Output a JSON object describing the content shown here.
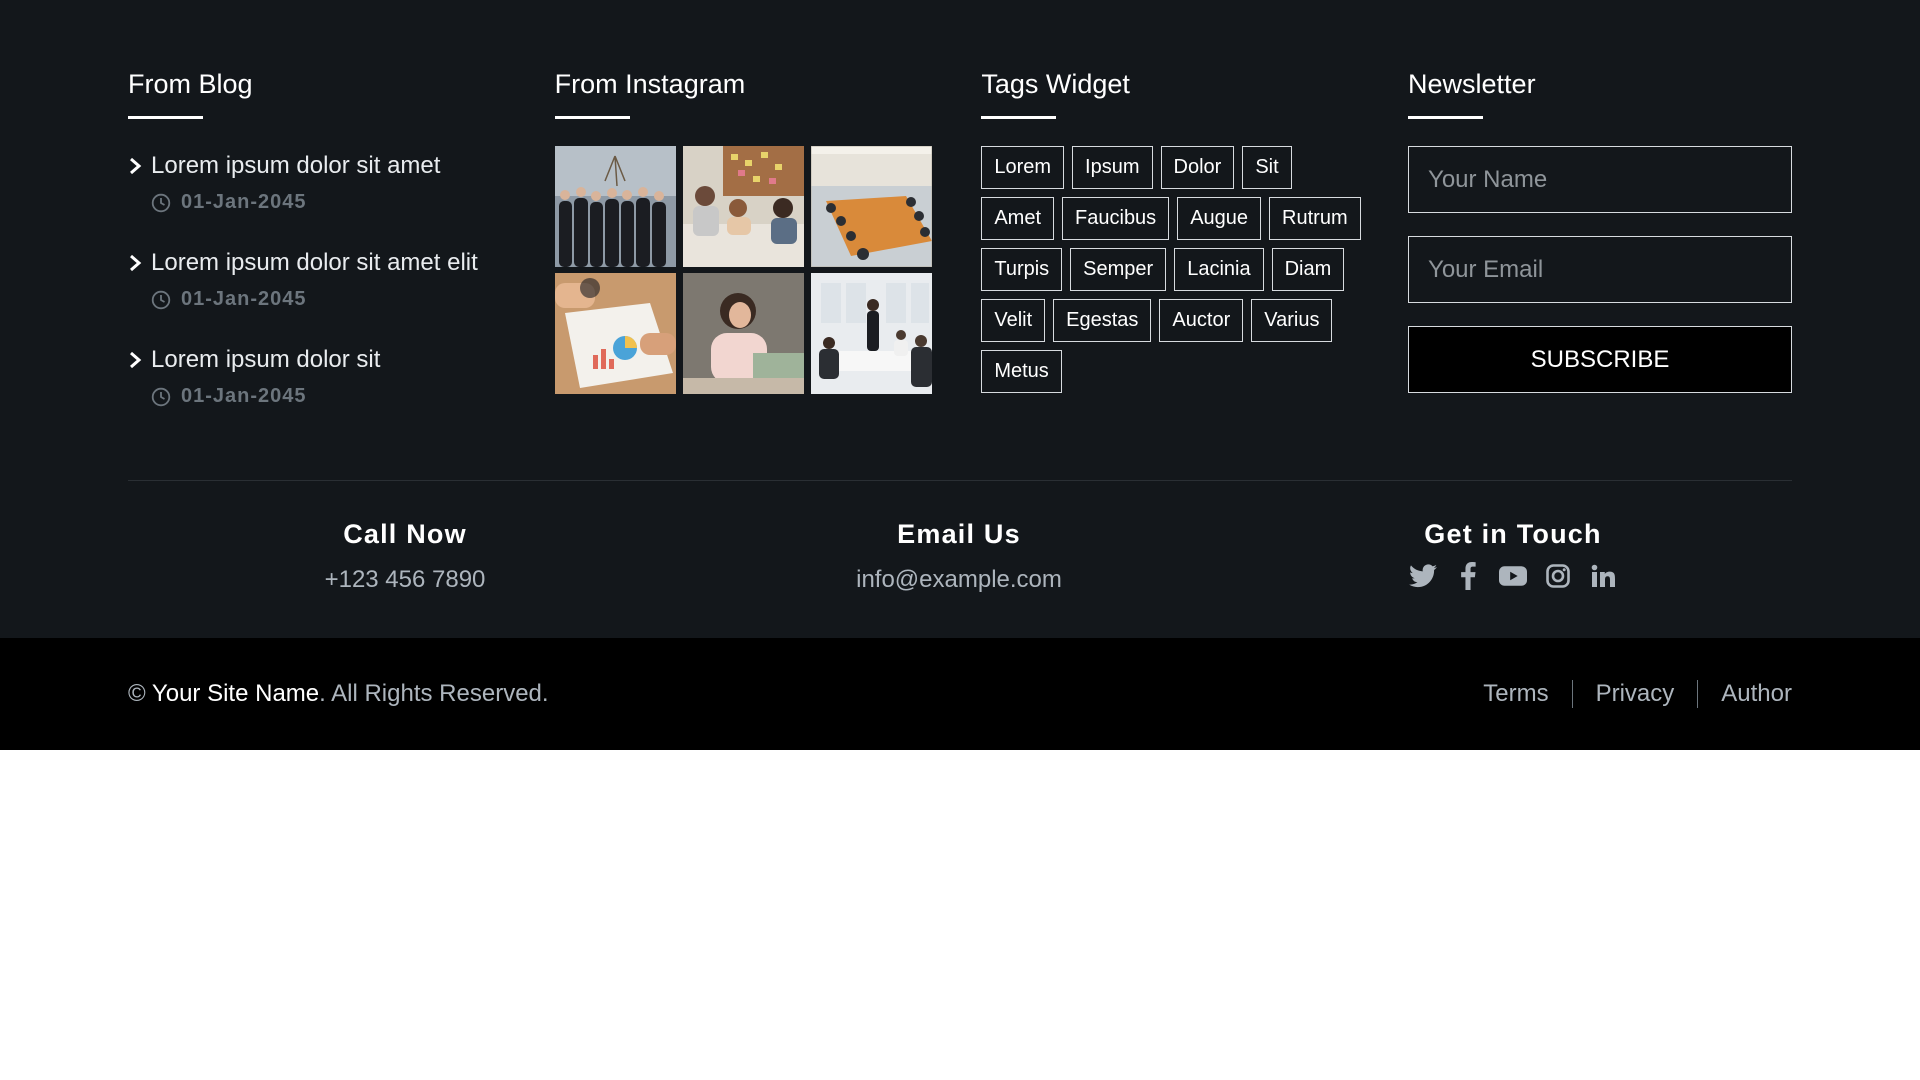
{
  "blog": {
    "title": "From Blog",
    "posts": [
      {
        "title": "Lorem ipsum dolor sit amet",
        "date": "01-Jan-2045"
      },
      {
        "title": "Lorem ipsum dolor sit amet elit",
        "date": "01-Jan-2045"
      },
      {
        "title": "Lorem ipsum dolor sit",
        "date": "01-Jan-2045"
      }
    ]
  },
  "instagram": {
    "title": "From Instagram",
    "photos": [
      "team-group-photo",
      "meeting-sticky-notes",
      "conference-room",
      "charts-on-desk",
      "woman-with-laptop",
      "office-meeting"
    ]
  },
  "tags": {
    "title": "Tags Widget",
    "items": [
      "Lorem",
      "Ipsum",
      "Dolor",
      "Sit",
      "Amet",
      "Faucibus",
      "Augue",
      "Rutrum",
      "Turpis",
      "Semper",
      "Lacinia",
      "Diam",
      "Velit",
      "Egestas",
      "Auctor",
      "Varius",
      "Metus"
    ]
  },
  "newsletter": {
    "title": "Newsletter",
    "name_placeholder": "Your Name",
    "email_placeholder": "Your Email",
    "button_label": "SUBSCRIBE"
  },
  "contact": {
    "call_title": "Call Now",
    "phone": "+123 456 7890",
    "email_title": "Email Us",
    "email": "info@example.com",
    "touch_title": "Get in Touch",
    "socials": [
      "twitter-icon",
      "facebook-icon",
      "youtube-icon",
      "instagram-icon",
      "linkedin-icon"
    ]
  },
  "bottom": {
    "copyright_symbol": "©",
    "site_name": "Your Site Name",
    "rights": ". All Rights Reserved.",
    "links": [
      "Terms",
      "Privacy",
      "Author"
    ]
  },
  "colors": {
    "footer_bg": "#13171b",
    "bottom_bg": "#000000",
    "muted_text": "#adb5bd",
    "date_text": "#6c757d"
  }
}
